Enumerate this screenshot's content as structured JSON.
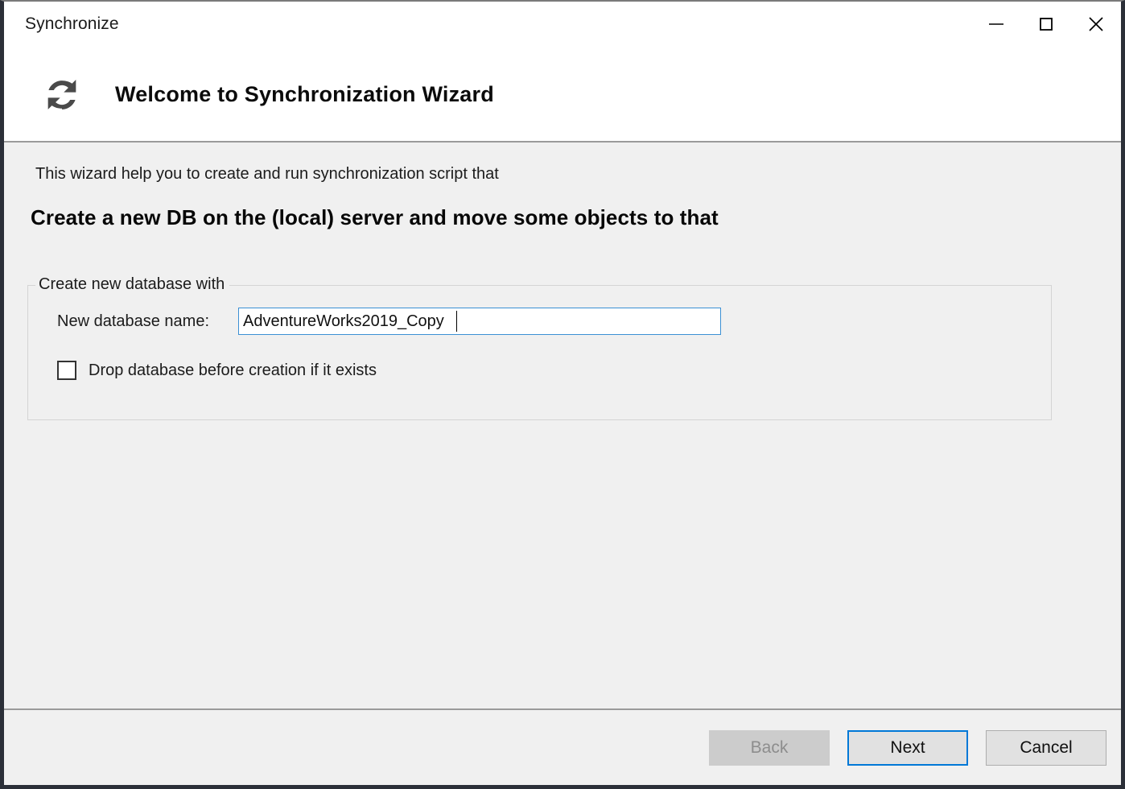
{
  "window": {
    "title": "Synchronize",
    "controls": {
      "minimize": "minimize-icon",
      "maximize": "maximize-icon",
      "close": "close-icon"
    }
  },
  "header": {
    "icon": "sync-refresh-icon",
    "title": "Welcome to Synchronization Wizard"
  },
  "body": {
    "intro": "This wizard help you to create and run synchronization script that",
    "headline": "Create a new DB on the (local) server and move some objects to that",
    "group": {
      "legend": "Create new database with",
      "name_label": "New database name:",
      "name_value": "AdventureWorks2019_Copy",
      "name_placeholder": "",
      "checkbox_label": "Drop database before creation if it exists",
      "checkbox_checked": false
    }
  },
  "footer": {
    "back_label": "Back",
    "back_enabled": false,
    "next_label": "Next",
    "cancel_label": "Cancel"
  },
  "colors": {
    "accent": "#0078d7",
    "body_bg": "#f0f0f0",
    "header_bg": "#ffffff",
    "window_border": "#2b2f38",
    "separator": "#9a9a9a",
    "input_border_focus": "#3b90d4",
    "disabled_text": "#8d8d8d",
    "icon_gray": "#4a4a4a"
  }
}
